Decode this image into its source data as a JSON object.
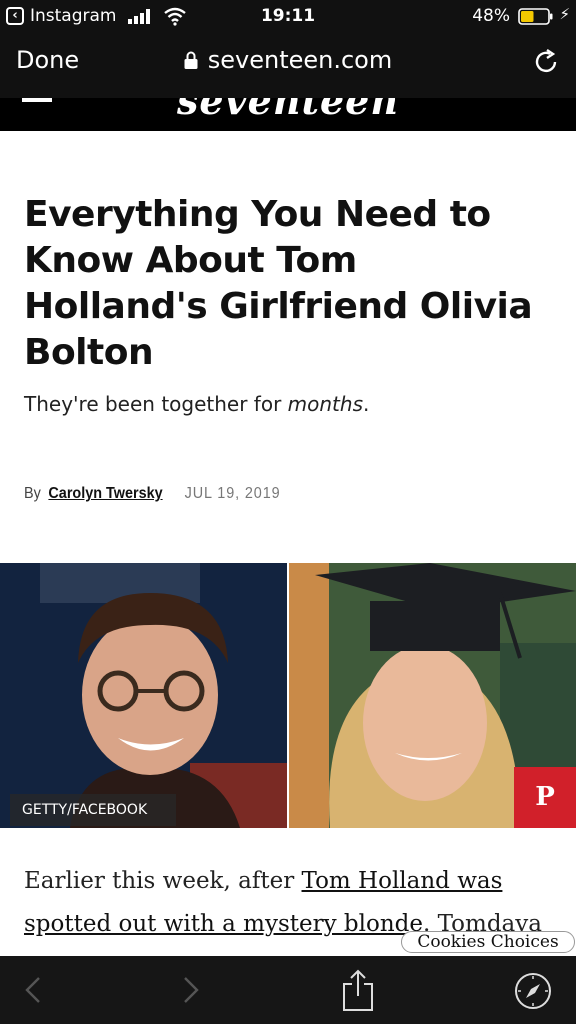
{
  "status_bar": {
    "app_name": "Instagram",
    "time": "19:11",
    "battery_pct": "48%",
    "battery_level": 0.48
  },
  "browser": {
    "done_label": "Done",
    "url": "seventeen.com"
  },
  "site": {
    "logo_text": "seventeen"
  },
  "article": {
    "headline": "Everything You Need to Know About Tom Holland's Girlfriend Olivia Bolton",
    "dek_prefix": "They're been together for ",
    "dek_emphasis": "months",
    "dek_suffix": ".",
    "byline_prefix": "By",
    "author": "Carolyn Twersky",
    "date": "JUL 19, 2019",
    "image_credit": "GETTY/FACEBOOK",
    "pin_label": "P",
    "body_start": "Earlier this week, after ",
    "body_link": "Tom Holland was spotted out with a mystery blonde",
    "body_after": ". Tomdaya"
  },
  "cookies_label": "Cookies Choices",
  "colors": {
    "chrome_bg": "#111111",
    "pinterest_red": "#d1202a",
    "battery_yellow": "#f4c800"
  }
}
